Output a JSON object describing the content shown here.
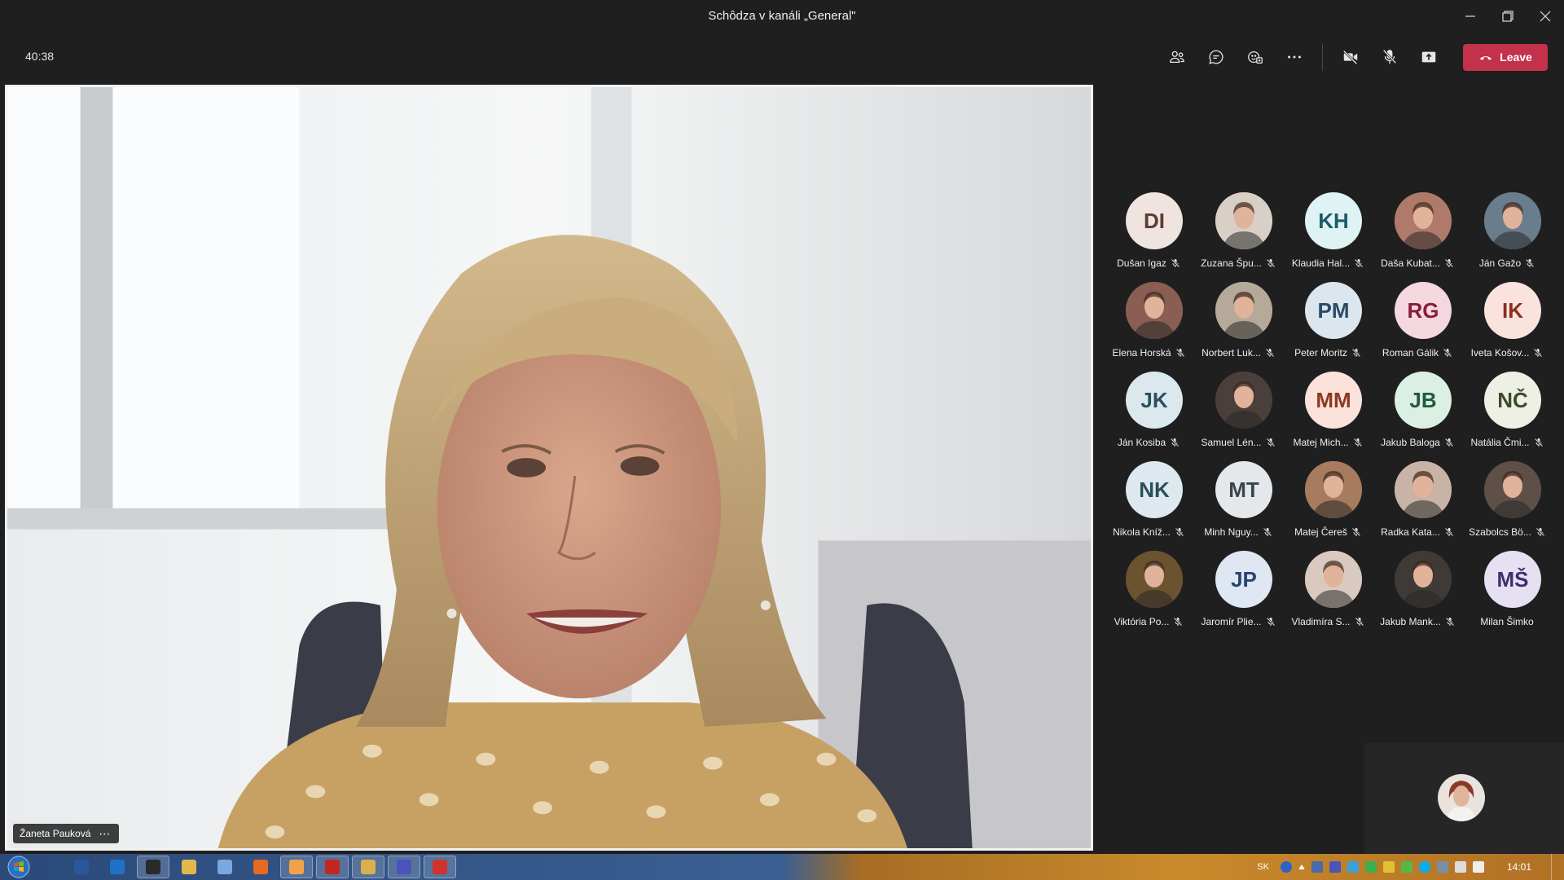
{
  "window": {
    "title": "Schôdza v kanáli „General\""
  },
  "toolbar": {
    "timer": "40:38",
    "tools": [
      {
        "name": "participants-icon"
      },
      {
        "name": "chat-icon"
      },
      {
        "name": "reactions-icon"
      },
      {
        "name": "more-icon"
      }
    ],
    "av_controls": [
      {
        "name": "camera-off-icon"
      },
      {
        "name": "mic-off-icon"
      },
      {
        "name": "share-icon"
      }
    ],
    "leave_label": "Leave",
    "leave_color": "#c4314b"
  },
  "stage": {
    "speaker_name": "Žaneta Pauková",
    "speaker_menu": "⋯"
  },
  "participants": [
    {
      "name": "Dušan Igaz",
      "initials": "DI",
      "color": "#f0e4e0",
      "text": "#5c3b32",
      "photo": false
    },
    {
      "name": "Zuzana Špu...",
      "initials": "",
      "color": "#d8cfc6",
      "text": "#333",
      "photo": true
    },
    {
      "name": "Klaudia Hal...",
      "initials": "KH",
      "color": "#dff2f4",
      "text": "#1c5d66",
      "photo": false
    },
    {
      "name": "Daša Kubat...",
      "initials": "",
      "color": "#b07a6a",
      "text": "#333",
      "photo": true
    },
    {
      "name": "Ján Gažo",
      "initials": "",
      "color": "#6a7d8c",
      "text": "#333",
      "photo": true
    },
    {
      "name": "Elena Horská",
      "initials": "",
      "color": "#8a5e52",
      "text": "#333",
      "photo": true
    },
    {
      "name": "Norbert Luk...",
      "initials": "",
      "color": "#b5a99a",
      "text": "#333",
      "photo": true
    },
    {
      "name": "Peter Moritz",
      "initials": "PM",
      "color": "#dbe6ee",
      "text": "#2c4a66",
      "photo": false
    },
    {
      "name": "Roman Gálik",
      "initials": "RG",
      "color": "#f5d7e0",
      "text": "#8a1c3b",
      "photo": false
    },
    {
      "name": "Iveta Košov...",
      "initials": "IK",
      "color": "#fbe3dd",
      "text": "#8b2f1e",
      "photo": false
    },
    {
      "name": "Ján Kosiba",
      "initials": "JK",
      "color": "#dbe9ee",
      "text": "#2b4f5e",
      "photo": false
    },
    {
      "name": "Samuel Lén...",
      "initials": "",
      "color": "#4a3f3a",
      "text": "#333",
      "photo": true
    },
    {
      "name": "Matej Mich...",
      "initials": "MM",
      "color": "#fbe2da",
      "text": "#8a3a22",
      "photo": false
    },
    {
      "name": "Jakub Baloga",
      "initials": "JB",
      "color": "#dcefe4",
      "text": "#235a3c",
      "photo": false
    },
    {
      "name": "Natália Čmi...",
      "initials": "NČ",
      "color": "#eef0e6",
      "text": "#3c4a2a",
      "photo": false
    },
    {
      "name": "Nikola Kníž...",
      "initials": "NK",
      "color": "#dde9ee",
      "text": "#2b4d5c",
      "photo": false
    },
    {
      "name": "Minh Nguy...",
      "initials": "MT",
      "color": "#e4e8ea",
      "text": "#38464d",
      "photo": false
    },
    {
      "name": "Matej Čereš",
      "initials": "",
      "color": "#a77b5e",
      "text": "#333",
      "photo": true
    },
    {
      "name": "Radka Kata...",
      "initials": "",
      "color": "#c9b3a6",
      "text": "#333",
      "photo": true
    },
    {
      "name": "Szabolcs Bö...",
      "initials": "",
      "color": "#5e5048",
      "text": "#333",
      "photo": true
    },
    {
      "name": "Viktória Po...",
      "initials": "",
      "color": "#6b5330",
      "text": "#333",
      "photo": true
    },
    {
      "name": "Jaromír Plie...",
      "initials": "JP",
      "color": "#dfe7f3",
      "text": "#2a446e",
      "photo": false
    },
    {
      "name": "Vladimíra S...",
      "initials": "",
      "color": "#d9c9bf",
      "text": "#333",
      "photo": true
    },
    {
      "name": "Jakub Mank...",
      "initials": "",
      "color": "#3f3a36",
      "text": "#333",
      "photo": true
    },
    {
      "name": "Milan Šimko",
      "initials": "MŠ",
      "color": "#e6e1f2",
      "text": "#3d2f6e",
      "photo": false
    }
  ],
  "taskbar": {
    "items": [
      {
        "name": "word-icon",
        "color": "#2b579a"
      },
      {
        "name": "onedrive-icon",
        "color": "#1e73c6"
      },
      {
        "name": "clock-app-icon",
        "color": "#2a2a2a"
      },
      {
        "name": "explorer-icon",
        "color": "#e2b84c"
      },
      {
        "name": "notepad-icon",
        "color": "#7aa7e0"
      },
      {
        "name": "firefox-icon",
        "color": "#e66a1f"
      },
      {
        "name": "media-player-icon",
        "color": "#f0a24a"
      },
      {
        "name": "acrobat-icon",
        "color": "#c3271f"
      },
      {
        "name": "folder-icon",
        "color": "#d8b04e"
      },
      {
        "name": "teams-icon",
        "color": "#4b53bc"
      },
      {
        "name": "screen-record-icon",
        "color": "#d0332d"
      }
    ],
    "tray_language": "SK",
    "clock": "14:01"
  }
}
